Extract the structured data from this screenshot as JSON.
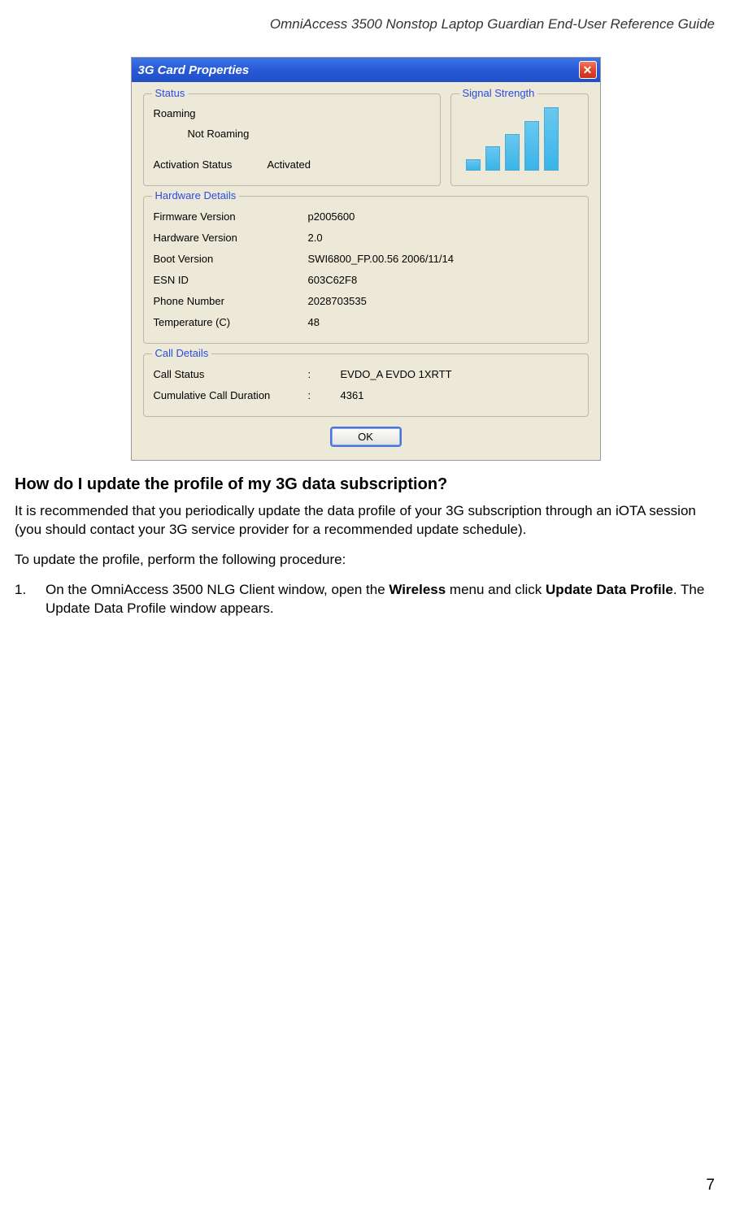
{
  "header": "OmniAccess 3500 Nonstop Laptop Guardian End-User Reference Guide",
  "dialog": {
    "title": "3G Card Properties",
    "close": "✕",
    "status": {
      "legend": "Status",
      "roaming_label": "Roaming",
      "roaming_value": "Not Roaming",
      "activation_label": "Activation Status",
      "activation_value": "Activated"
    },
    "signal": {
      "legend": "Signal Strength"
    },
    "hardware": {
      "legend": "Hardware Details",
      "rows": [
        {
          "label": "Firmware Version",
          "value": "p2005600"
        },
        {
          "label": "Hardware Version",
          "value": "2.0"
        },
        {
          "label": "Boot Version",
          "value": "SWI6800_FP.00.56 2006/11/14"
        },
        {
          "label": "ESN ID",
          "value": "603C62F8"
        },
        {
          "label": "Phone Number",
          "value": "2028703535"
        },
        {
          "label": "Temperature (C)",
          "value": " 48"
        }
      ]
    },
    "call": {
      "legend": "Call Details",
      "rows": [
        {
          "label": "Call Status",
          "sep": ":",
          "value": "EVDO_A EVDO 1XRTT"
        },
        {
          "label": "Cumulative Call Duration",
          "sep": ":",
          "value": "4361"
        }
      ]
    },
    "ok": "OK"
  },
  "heading": "How do I update the profile of my 3G data subscription?",
  "para1": "It is recommended that you periodically update the data profile of your 3G subscription through an iOTA session (you should contact your 3G service provider for a recommended update schedule).",
  "para2": "To update the profile, perform the following procedure:",
  "step1": {
    "num": "1.",
    "pre": "On the OmniAccess 3500 NLG Client window, open the ",
    "b1": "Wireless",
    "mid": " menu and click ",
    "b2": "Update Data Profile",
    "post": ". The Update Data Profile window appears."
  },
  "pagenum": "7"
}
